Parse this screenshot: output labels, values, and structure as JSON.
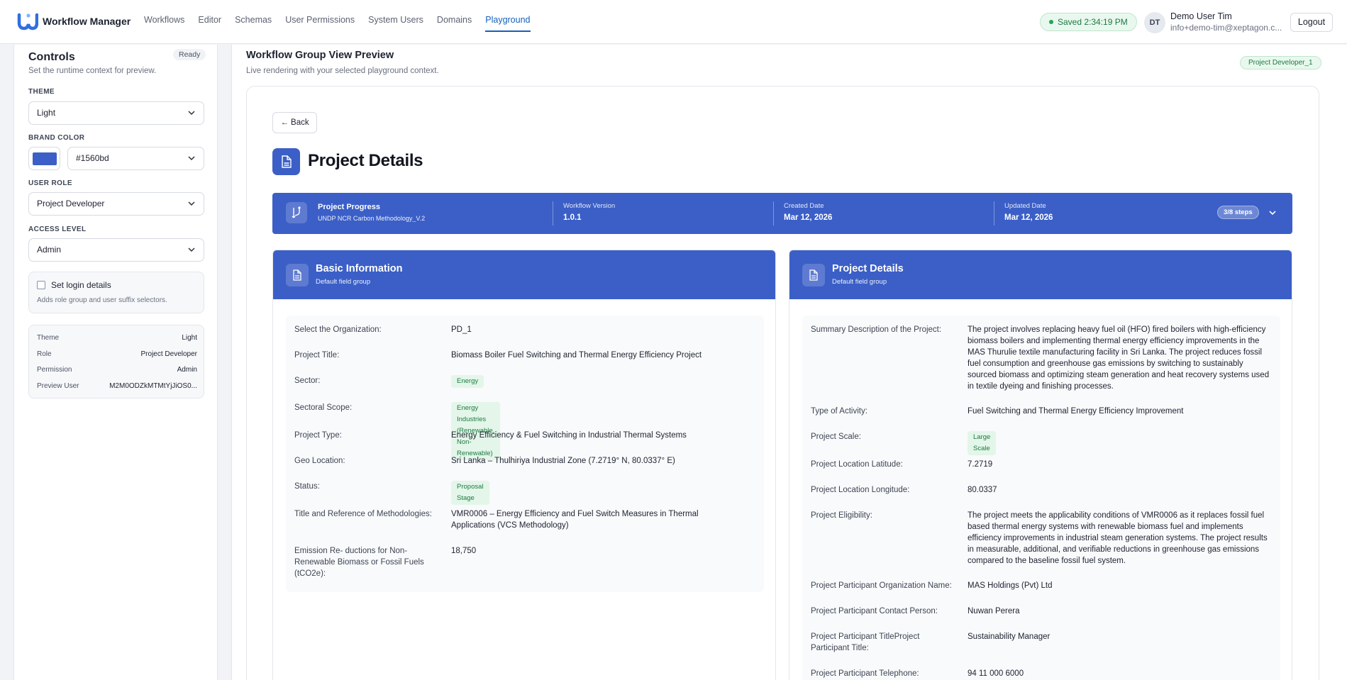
{
  "brand": {
    "name": "Workflow Manager",
    "logo_icon": "wu-logo-icon"
  },
  "nav": [
    "Workflows",
    "Editor",
    "Schemas",
    "User Permissions",
    "System Users",
    "Domains",
    "Playground"
  ],
  "status": {
    "saved": "Saved 2:34:19 PM"
  },
  "user": {
    "initials": "DT",
    "name": "Demo User Tim",
    "email": "info+demo-tim@xeptagon.c...",
    "logout": "Logout"
  },
  "controls": {
    "title": "Controls",
    "status": "Ready",
    "subtitle": "Set the runtime context for preview.",
    "theme_label": "THEME",
    "theme": "Light",
    "brand_color_label": "BRAND COLOR",
    "brand_color": "#1560bd",
    "swatch_color": "#3b5fc7",
    "user_role_label": "USER ROLE",
    "user_role": "Project Developer",
    "access_level_label": "ACCESS LEVEL",
    "access_level": "Admin",
    "login_label": "Set login details",
    "login_hint": "Adds role group and user suffix selectors.",
    "summary": [
      {
        "key": "Theme",
        "value": "Light"
      },
      {
        "key": "Role",
        "value": "Project Developer"
      },
      {
        "key": "Permission",
        "value": "Admin"
      },
      {
        "key": "Preview User",
        "value": "M2M0ODZkMTMtYjJiOS0..."
      }
    ]
  },
  "preview": {
    "title": "Workflow Group View Preview",
    "subtitle": "Live rendering with your selected playground context.",
    "role_badge": "Project Developer_1",
    "back": "← Back",
    "page_title": "Project Details",
    "accent": "#3b5fc7",
    "progress": {
      "title": "Project Progress",
      "subtitle": "UNDP NCR Carbon Methodology_V.2",
      "workflow_version_label": "Workflow Version",
      "workflow_version": "1.0.1",
      "created_label": "Created Date",
      "created": "Mar 12, 2026",
      "updated_label": "Updated Date",
      "updated": "Mar 12, 2026",
      "steps": "3/8 steps"
    },
    "basic": {
      "title": "Basic Information",
      "subtitle": "Default field group",
      "fields": [
        {
          "label": "Select the Organization:",
          "value": "PD_1"
        },
        {
          "label": "Project Title:",
          "value": "Biomass Boiler Fuel Switching and Thermal Energy Efficiency Project"
        },
        {
          "label": "Sector:",
          "value": "Energy"
        },
        {
          "label": "Sectoral Scope:",
          "value": "Energy Industries (Renewable, Non-Renewable)"
        },
        {
          "label": "Project Type:",
          "value": "Energy Efficiency & Fuel Switching in Industrial Thermal Systems"
        },
        {
          "label": "Geo Location:",
          "value": "Sri Lanka – Thulhiriya Industrial Zone (7.2719° N, 80.0337° E)"
        },
        {
          "label": "Status:",
          "value": "Proposal Stage"
        },
        {
          "label": "Title and Reference of Methodologies:",
          "value": "VMR0006 – Energy Efficiency and Fuel Switch Measures in Thermal Applications (VCS Methodology)"
        },
        {
          "label": "Emission Re- ductions for Non-Renewable Biomass or Fossil Fuels (tCO2e):",
          "value": "18,750"
        }
      ]
    },
    "details": {
      "title": "Project Details",
      "subtitle": "Default field group",
      "fields": [
        {
          "label": "Summary Description of the Project:",
          "value": "The project involves replacing heavy fuel oil (HFO) fired boilers with high-efficiency biomass boilers and implementing thermal energy efficiency improvements in the MAS Thurulie textile manufacturing facility in Sri Lanka. The project reduces fossil fuel consumption and greenhouse gas emissions by switching to sustainably sourced biomass and optimizing steam generation and heat recovery systems used in textile dyeing and finishing processes."
        },
        {
          "label": "Type of Activity:",
          "value": "Fuel Switching and Thermal Energy Efficiency Improvement"
        },
        {
          "label": "Project Scale:",
          "value": "Large Scale"
        },
        {
          "label": "Project Location Latitude:",
          "value": "7.2719"
        },
        {
          "label": "Project Location Longitude:",
          "value": "80.0337"
        },
        {
          "label": "Project Eligibility:",
          "value": "The project meets the applicability conditions of VMR0006 as it replaces fossil fuel based thermal energy systems with renewable biomass fuel and implements efficiency improvements in industrial steam generation systems. The project results in measurable, additional, and verifiable reductions in greenhouse gas emissions compared to the baseline fossil fuel system."
        },
        {
          "label": "Project Participant Organization Name:",
          "value": "MAS Holdings (Pvt) Ltd"
        },
        {
          "label": "Project Participant Contact Person:",
          "value": "Nuwan Perera"
        },
        {
          "label": "Project Participant TitleProject Participant Title:",
          "value": "Sustainability Manager"
        },
        {
          "label": "Project Participant Telephone:",
          "value": "94 11 000 6000"
        }
      ]
    }
  }
}
